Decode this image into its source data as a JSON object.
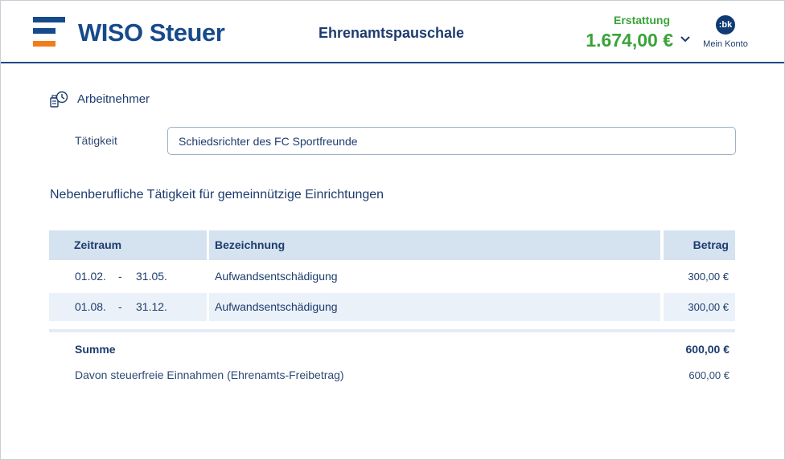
{
  "header": {
    "logo_text": "WISO Steuer",
    "page_title": "Ehrenamtspauschale",
    "refund_label": "Erstattung",
    "refund_amount": "1.674,00 €",
    "account_avatar": ":bk",
    "account_label": "Mein Konto",
    "brand_color": "#174a8b",
    "accent_color": "#f07d1a",
    "refund_color": "#3aa33a"
  },
  "section": {
    "icon": "employee-clock-icon",
    "title": "Arbeitnehmer"
  },
  "taetigkeit": {
    "label": "Tätigkeit",
    "value": "Schiedsrichter des FC Sportfreunde"
  },
  "subheading": "Nebenberufliche Tätigkeit für gemeinnützige Einrichtungen",
  "table": {
    "headers": {
      "zeitraum": "Zeitraum",
      "bezeichnung": "Bezeichnung",
      "betrag": "Betrag"
    },
    "rows": [
      {
        "from": "01.02.",
        "sep": "-",
        "to": "31.05.",
        "bezeichnung": "Aufwandsentschädigung",
        "betrag": "300,00 €"
      },
      {
        "from": "01.08.",
        "sep": "-",
        "to": "31.12.",
        "bezeichnung": "Aufwandsentschädigung",
        "betrag": "300,00 €"
      }
    ]
  },
  "summary": {
    "sum_label": "Summe",
    "sum_value": "600,00 €",
    "free_label": "Davon steuerfreie Einnahmen (Ehrenamts-Freibetrag)",
    "free_value": "600,00 €"
  }
}
